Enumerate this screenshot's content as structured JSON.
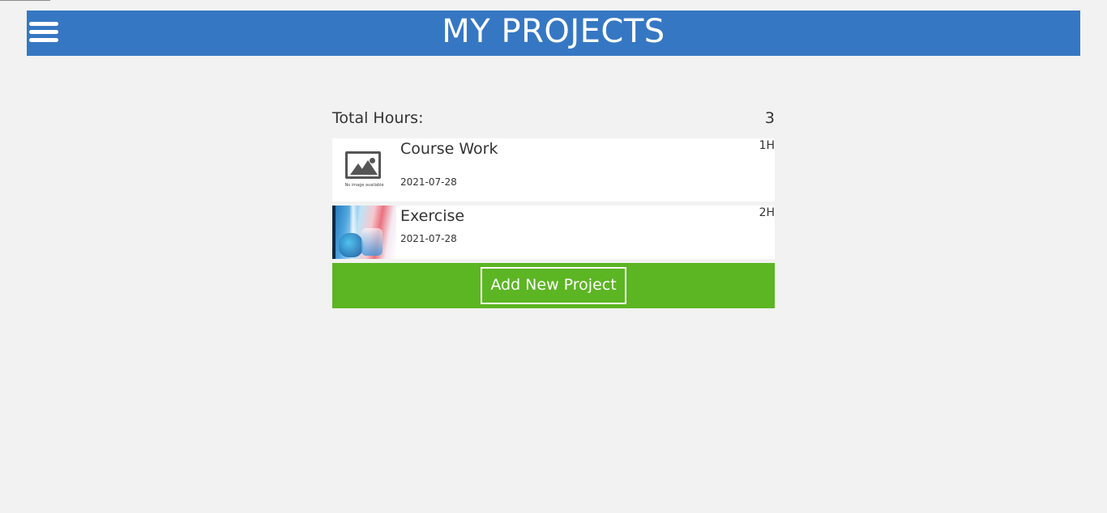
{
  "header": {
    "title": "MY PROJECTS",
    "menu_icon": "hamburger-menu-icon"
  },
  "summary": {
    "total_label": "Total Hours:",
    "total_value": "3"
  },
  "projects": [
    {
      "name": "Course Work",
      "date": "2021-07-28",
      "hours": "1H",
      "thumbnail": "no-image-placeholder",
      "thumbnail_caption": "No image available"
    },
    {
      "name": "Exercise",
      "date": "2021-07-28",
      "hours": "2H",
      "thumbnail": "lab-flasks-photo"
    }
  ],
  "actions": {
    "add_label": "Add New Project"
  },
  "colors": {
    "header_bg": "#3677c3",
    "page_bg": "#f1f2f1",
    "add_bar_bg": "#5cb523",
    "card_bg": "#ffffff",
    "text": "#333333"
  }
}
